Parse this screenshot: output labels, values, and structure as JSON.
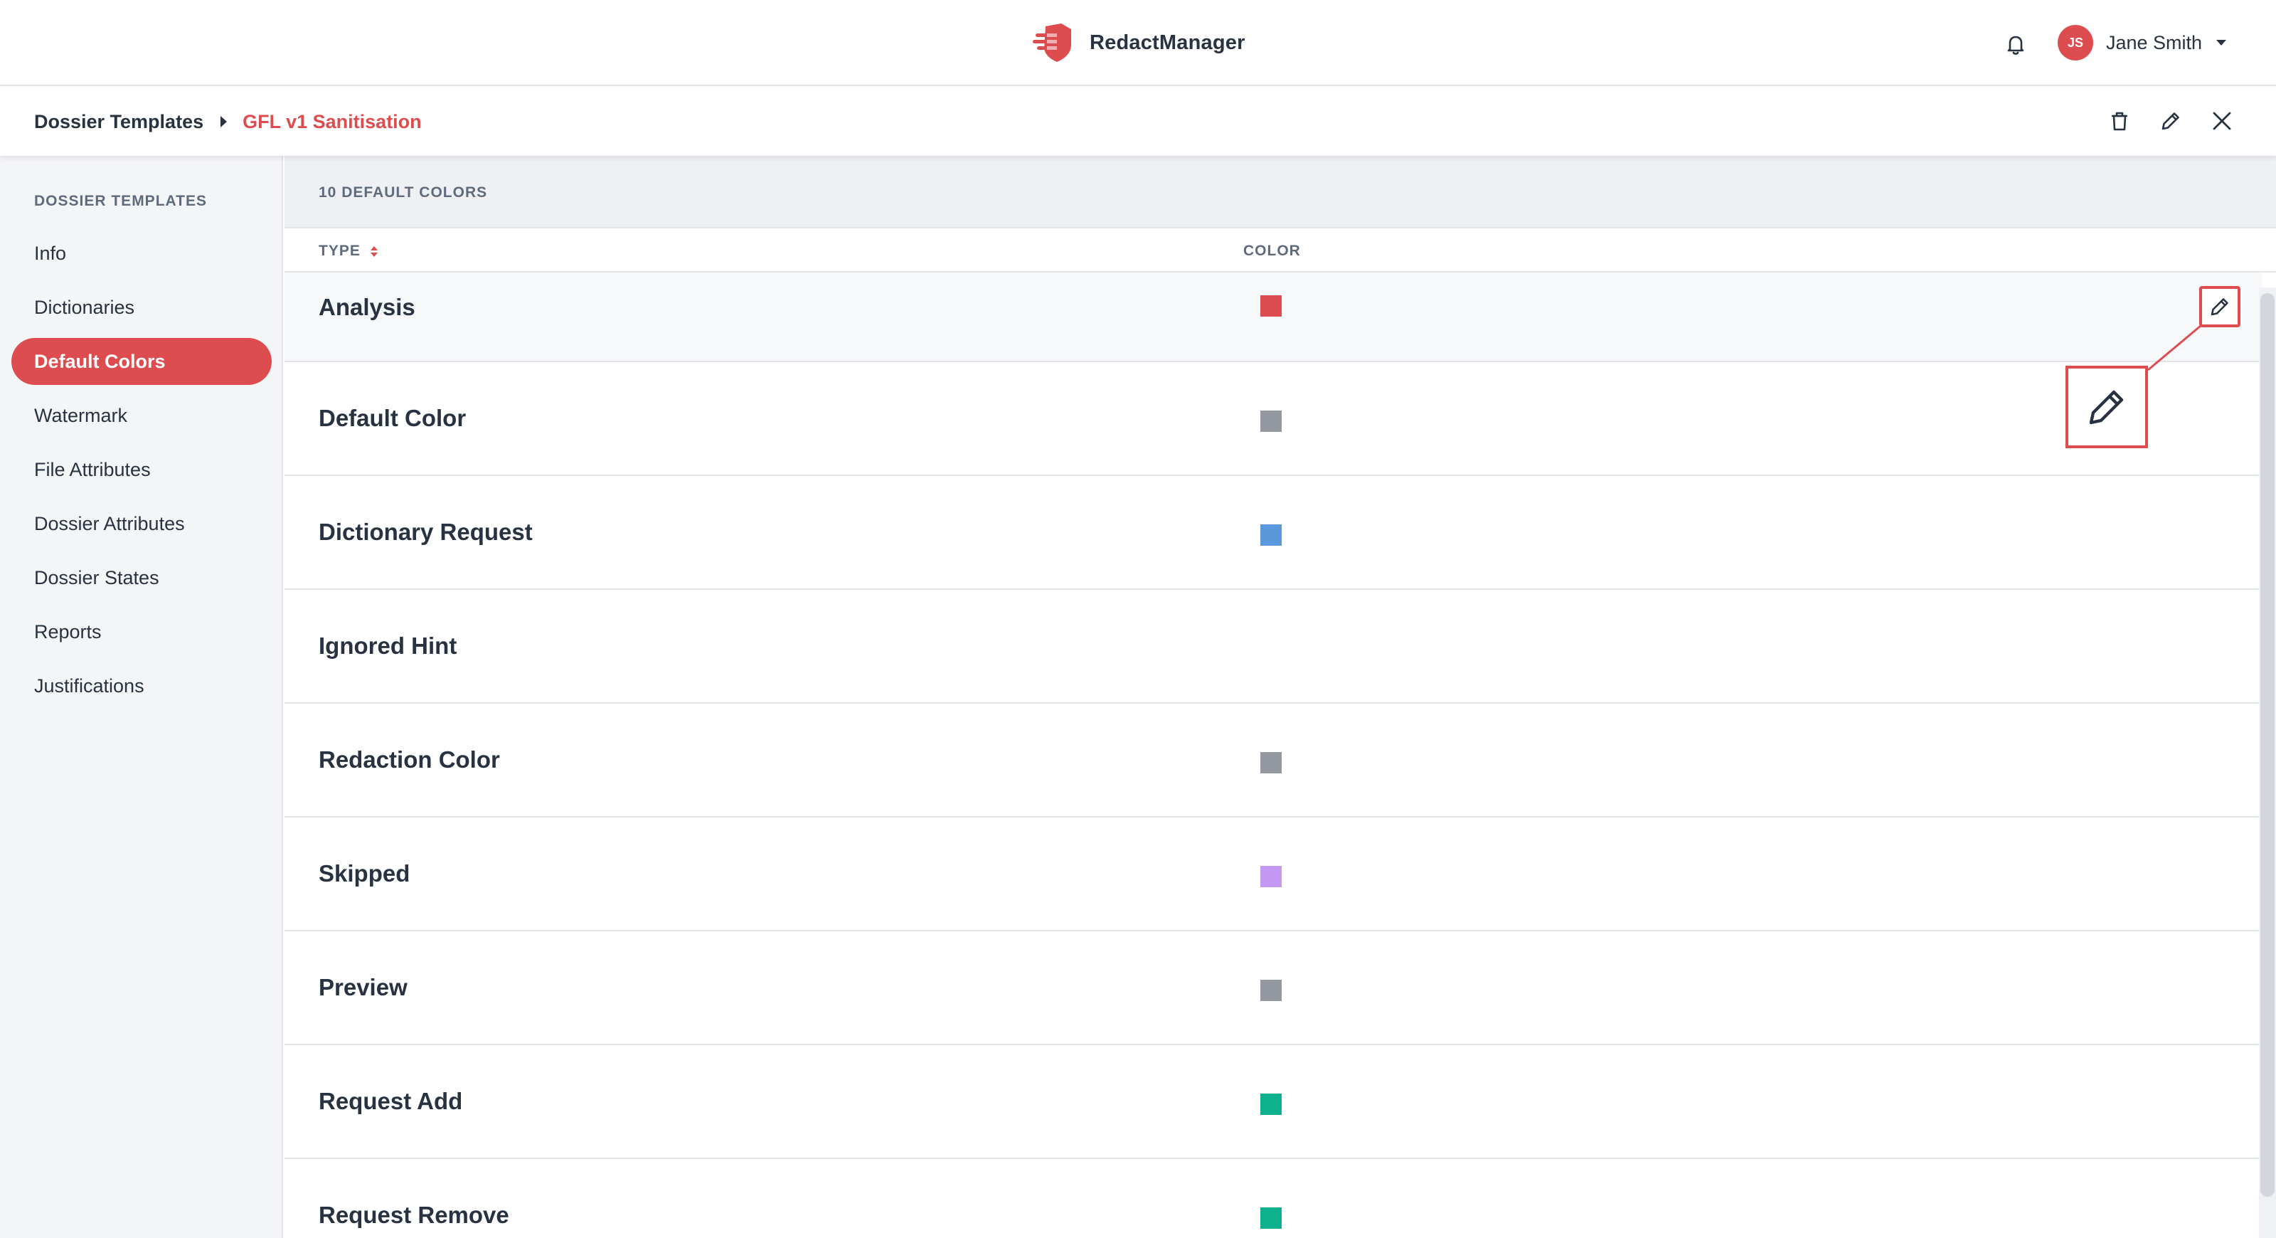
{
  "header": {
    "brand": "RedactManager",
    "user": {
      "initials": "JS",
      "name": "Jane Smith"
    }
  },
  "breadcrumb": {
    "root": "Dossier Templates",
    "current": "GFL v1 Sanitisation"
  },
  "sidebar": {
    "heading": "DOSSIER TEMPLATES",
    "items": [
      {
        "label": "Info"
      },
      {
        "label": "Dictionaries"
      },
      {
        "label": "Default Colors",
        "active": true
      },
      {
        "label": "Watermark"
      },
      {
        "label": "File Attributes"
      },
      {
        "label": "Dossier Attributes"
      },
      {
        "label": "Dossier States"
      },
      {
        "label": "Reports"
      },
      {
        "label": "Justifications"
      }
    ]
  },
  "main": {
    "count_label": "10 DEFAULT COLORS",
    "columns": {
      "type": "TYPE",
      "color": "COLOR"
    },
    "rows": [
      {
        "type": "Analysis",
        "color": "#dd4d50"
      },
      {
        "type": "Default Color",
        "color": "#9398a0"
      },
      {
        "type": "Dictionary Request",
        "color": "#5b97db"
      },
      {
        "type": "Ignored Hint",
        "color": null
      },
      {
        "type": "Redaction Color",
        "color": "#9398a0"
      },
      {
        "type": "Skipped",
        "color": "#c498f3"
      },
      {
        "type": "Preview",
        "color": "#9398a0"
      },
      {
        "type": "Request Add",
        "color": "#0fb08d"
      },
      {
        "type": "Request Remove",
        "color": "#0fb08d"
      }
    ]
  },
  "colors": {
    "accent": "#dd4d50",
    "text": "#283241",
    "muted": "#5f6b7d"
  }
}
